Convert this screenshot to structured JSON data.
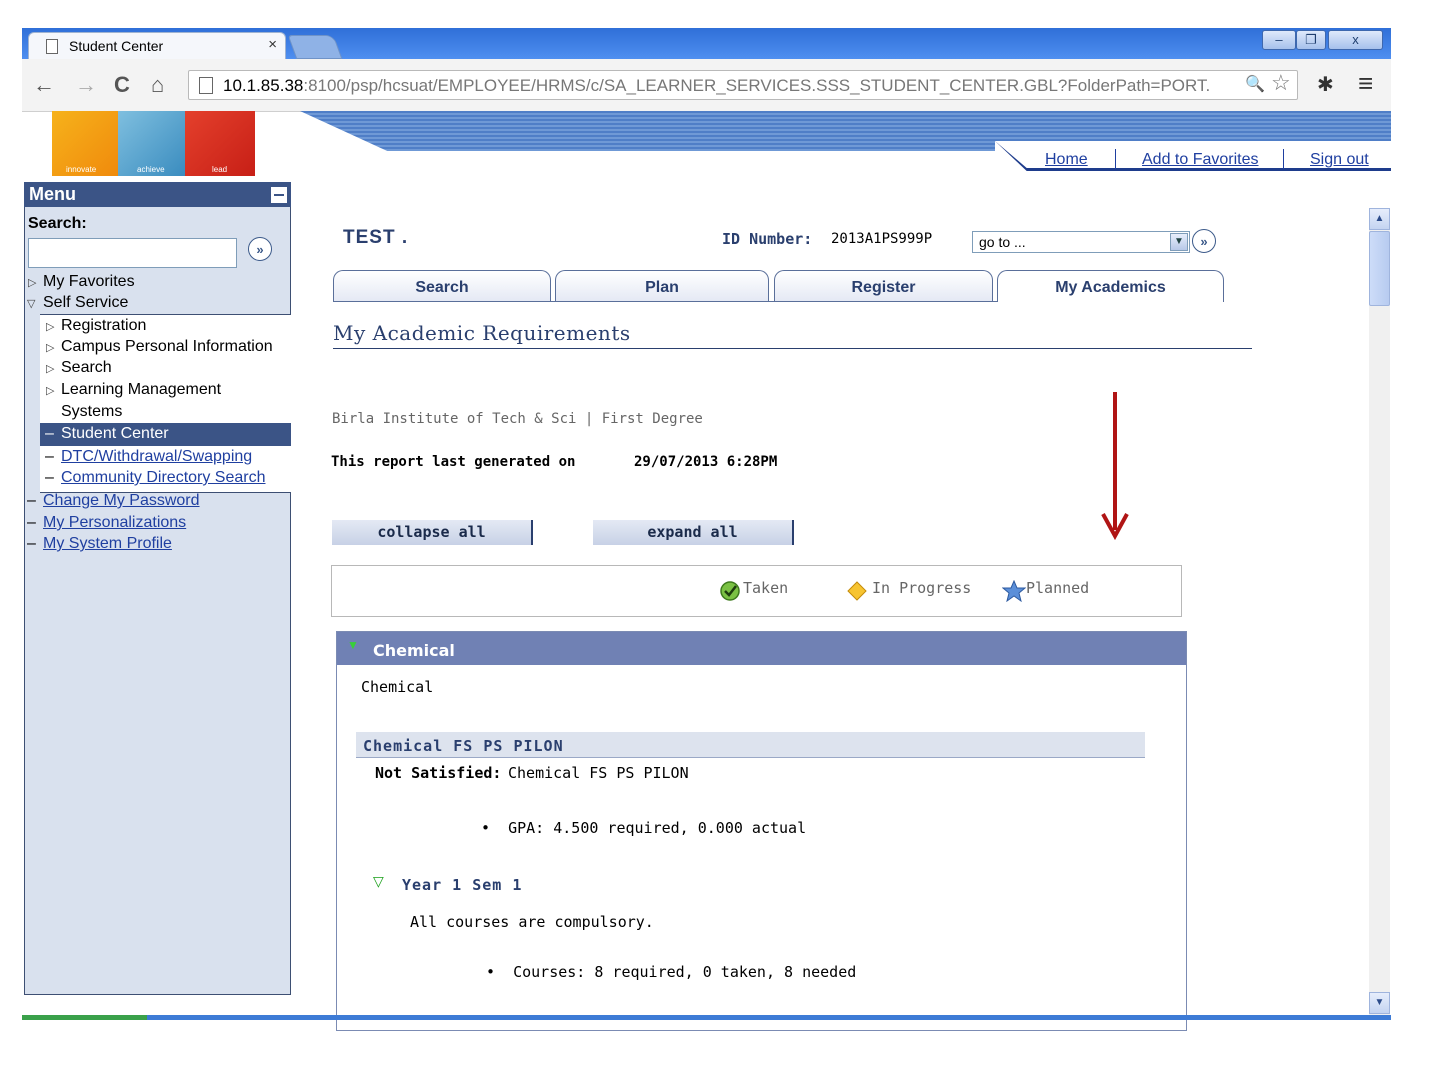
{
  "browser": {
    "tab_title": "Student Center",
    "tab_close": "×",
    "url_host": "10.1.85.38",
    "url_rest": ":8100/psp/hcsuat/EMPLOYEE/HRMS/c/SA_LEARNER_SERVICES.SSS_STUDENT_CENTER.GBL?FolderPath=PORT.",
    "back_icon": "←",
    "forward_icon": "→",
    "reload_icon": "C",
    "home_icon": "⌂",
    "zoom_icon": "🔍",
    "star_icon": "☆",
    "extension_icon": "✱",
    "menu_icon": "≡",
    "minimize": "–",
    "restore": "❐",
    "close": "x"
  },
  "logo": {
    "words": [
      "innovate",
      "achieve",
      "lead"
    ]
  },
  "header": {
    "links": [
      "Home",
      "Add to Favorites",
      "Sign out"
    ]
  },
  "menu": {
    "title": "Menu",
    "search_label": "Search:",
    "search_value": "",
    "search_go": "»",
    "items": [
      {
        "label": "My Favorites",
        "marker": "▷",
        "type": "folder"
      },
      {
        "label": "Self Service",
        "marker": "▽",
        "type": "folder"
      },
      {
        "label": "Registration",
        "marker": "▷",
        "type": "folder"
      },
      {
        "label": "Campus Personal Information",
        "marker": "▷",
        "type": "folder"
      },
      {
        "label": "Search",
        "marker": "▷",
        "type": "folder"
      },
      {
        "label": "Learning Management",
        "marker": "▷",
        "type": "folder"
      },
      {
        "label": "Systems",
        "marker": "",
        "type": "folder-cont"
      },
      {
        "label": "Student Center",
        "marker": "–",
        "type": "selected"
      },
      {
        "label": "DTC/Withdrawal/Swapping",
        "marker": "–",
        "type": "link"
      },
      {
        "label": "Community Directory Search",
        "marker": "–",
        "type": "link"
      },
      {
        "label": "Change My Password",
        "marker": "–",
        "type": "link"
      },
      {
        "label": "My Personalizations",
        "marker": "–",
        "type": "link"
      },
      {
        "label": "My System Profile",
        "marker": "–",
        "type": "link"
      }
    ]
  },
  "student": {
    "name": "TEST .",
    "id_label": "ID Number:",
    "id_value": "2013A1PS999P",
    "goto_value": "go to ...",
    "goto_go": "»"
  },
  "tabs": [
    {
      "label": "Search"
    },
    {
      "label": "Plan"
    },
    {
      "label": "Register"
    },
    {
      "label": "My Academics",
      "active": true
    }
  ],
  "page": {
    "title": "My Academic Requirements",
    "institution": "Birla Institute of Tech & Sci | First Degree",
    "generated_label": "This report last generated on",
    "generated_value": "29/07/2013  6:28PM",
    "collapse_all": "collapse all",
    "expand_all": "expand all"
  },
  "legend": {
    "taken": "Taken",
    "in_progress": "In Progress",
    "planned": "Planned"
  },
  "requirement": {
    "header": "Chemical",
    "description": "Chemical",
    "sub_header": "Chemical FS PS PILON",
    "status_label": "Not Satisfied:",
    "status_value": "Chemical FS PS PILON",
    "gpa_line": "GPA: 4.500 required, 0.000 actual",
    "group_header": "Year 1 Sem 1",
    "group_note": "All courses are compulsory.",
    "courses_line": "Courses: 8 required, 0 taken, 8 needed"
  },
  "colors": {
    "menu_header": "#3b5486",
    "section_header": "#7081b4",
    "accent_text": "#2a3f6e",
    "link": "#1f3fa0",
    "annotation_arrow": "#b01515"
  }
}
